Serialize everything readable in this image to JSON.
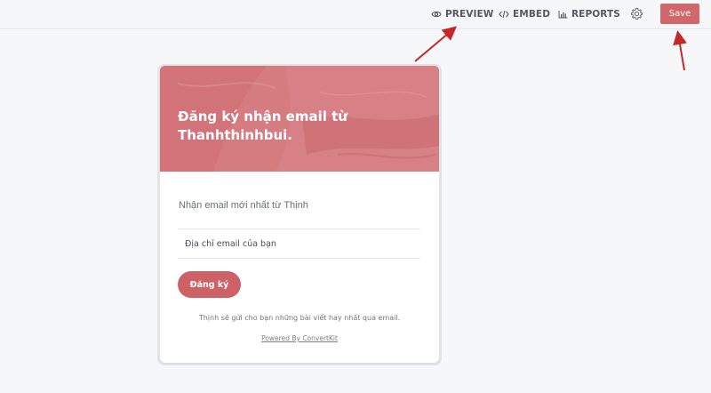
{
  "toolbar": {
    "preview_label": "PREVIEW",
    "preview_icon": "eye-icon",
    "embed_label": "EMBED",
    "embed_icon": "code-icon",
    "reports_label": "REPORTS",
    "reports_icon": "bar-chart-icon",
    "settings_icon": "gear-icon",
    "save_label": "Save"
  },
  "form": {
    "headline": "Đăng ký nhận email từ Thanhthinhbui.",
    "subheader": "Nhận email mới nhất từ Thịnh",
    "email_placeholder": "Địa chỉ email của bạn",
    "email_value": "",
    "submit_label": "Đăng ký",
    "disclaimer": "Thịnh sẽ gửi cho bạn những bài viết hay nhất qua email.",
    "powered_by": "Powered By ConvertKit"
  },
  "colors": {
    "accent": "#d0676b",
    "hero_overlay": "#d57c81",
    "background": "#f6f7f9",
    "annotation_arrow": "#c62828"
  }
}
